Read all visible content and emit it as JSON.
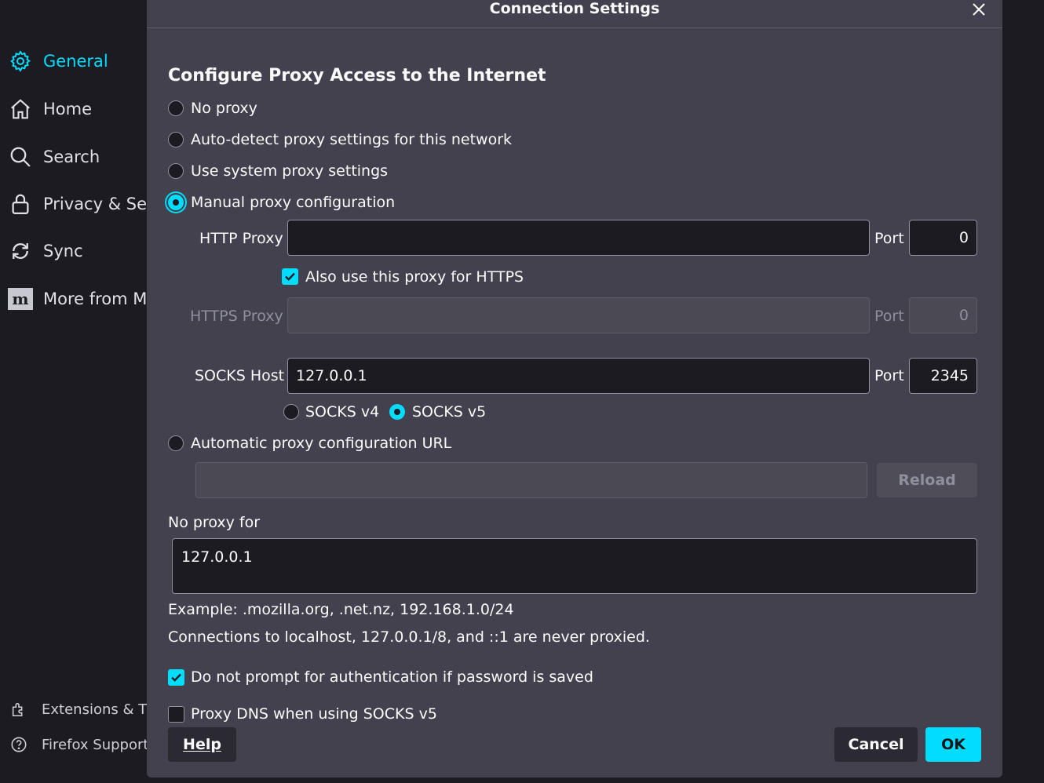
{
  "sidebar": {
    "items": [
      {
        "label": "General",
        "icon": "gear-icon"
      },
      {
        "label": "Home",
        "icon": "home-icon"
      },
      {
        "label": "Search",
        "icon": "search-icon"
      },
      {
        "label": "Privacy & Sec",
        "icon": "lock-icon"
      },
      {
        "label": "Sync",
        "icon": "sync-icon"
      },
      {
        "label": "More from M",
        "icon": "mozilla-icon"
      }
    ],
    "footer": [
      {
        "label": "Extensions & Th",
        "icon": "puzzle-icon"
      },
      {
        "label": "Firefox Support",
        "icon": "help-icon"
      }
    ]
  },
  "dialog": {
    "title": "Connection Settings",
    "heading": "Configure Proxy Access to the Internet",
    "options": {
      "no_proxy": "No proxy",
      "auto_detect": "Auto-detect proxy settings for this network",
      "system": "Use system proxy settings",
      "manual": "Manual proxy configuration",
      "auto_url": "Automatic proxy configuration URL"
    },
    "selected_option": "manual",
    "http": {
      "label": "HTTP Proxy",
      "value": "",
      "port_label": "Port",
      "port": "0"
    },
    "also_https": {
      "label": "Also use this proxy for HTTPS",
      "checked": true
    },
    "https": {
      "label": "HTTPS Proxy",
      "value": "",
      "port_label": "Port",
      "port": "0"
    },
    "socks": {
      "label": "SOCKS Host",
      "value": "127.0.0.1",
      "port_label": "Port",
      "port": "2345",
      "v4": "SOCKS v4",
      "v5": "SOCKS v5",
      "version": "v5"
    },
    "auto_url_value": "",
    "reload": "Reload",
    "no_proxy_for": {
      "label": "No proxy for",
      "value": "127.0.0.1"
    },
    "example": "Example: .mozilla.org, .net.nz, 192.168.1.0/24",
    "localhost_note": "Connections to localhost, 127.0.0.1/8, and ::1 are never proxied.",
    "no_prompt_auth": {
      "label": "Do not prompt for authentication if password is saved",
      "checked": true
    },
    "proxy_dns": {
      "label": "Proxy DNS when using SOCKS v5",
      "checked": false
    },
    "buttons": {
      "help": "Help",
      "cancel": "Cancel",
      "ok": "OK"
    }
  },
  "colors": {
    "accent": "#00ddff",
    "dialog_bg": "#42414d",
    "page_bg": "#1c1b22"
  }
}
